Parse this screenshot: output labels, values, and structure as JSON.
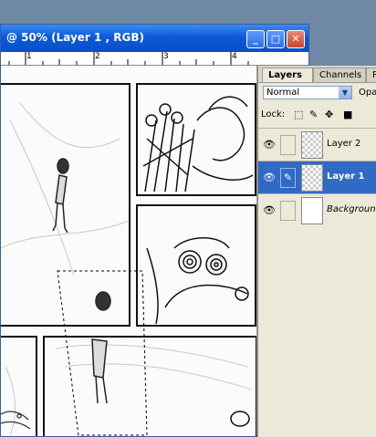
{
  "window": {
    "title": "@ 50% (Layer 1 , RGB)",
    "buttons": {
      "minimize": "_",
      "maximize": "□",
      "close": "✕"
    }
  },
  "ruler": {
    "ticks": [
      "1",
      "2",
      "3",
      "4"
    ]
  },
  "layers_panel": {
    "tabs": [
      "Layers",
      "Channels",
      "P"
    ],
    "blend_mode": "Normal",
    "opacity_label": "Opa",
    "lock_label": "Lock:",
    "layers": [
      {
        "name": "Layer 2",
        "visible": true,
        "selected": false
      },
      {
        "name": "Layer 1",
        "visible": true,
        "selected": true
      },
      {
        "name": "Background",
        "visible": true,
        "selected": false
      }
    ]
  },
  "icons": {
    "eye": "eye-icon",
    "brush": "brush-icon",
    "lock_transparent": "lock-transparent-icon",
    "lock_paint": "lock-paint-icon",
    "lock_move": "move-icon",
    "lock_all": "lock-icon"
  },
  "colors": {
    "titlebar": "#0b5ad8",
    "selected_layer": "#316ac5",
    "close_button": "#c9442c"
  }
}
